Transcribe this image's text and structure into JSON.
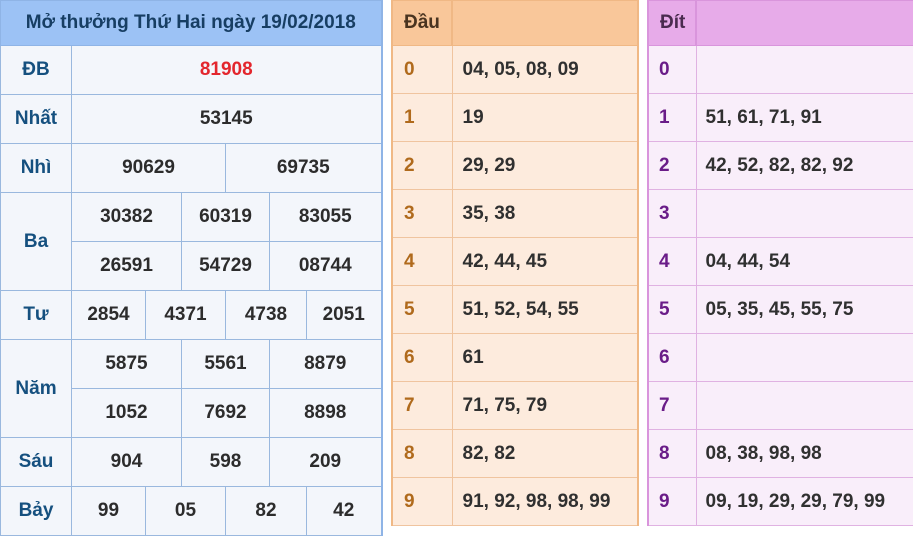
{
  "results": {
    "title": "Mở thưởng Thứ Hai ngày 19/02/2018",
    "rows": [
      {
        "label": "ĐB",
        "values": [
          "81908"
        ]
      },
      {
        "label": "Nhất",
        "values": [
          "53145"
        ]
      },
      {
        "label": "Nhì",
        "values": [
          "90629",
          "69735"
        ]
      },
      {
        "label": "Ba",
        "values": [
          "30382",
          "60319",
          "83055",
          "26591",
          "54729",
          "08744"
        ]
      },
      {
        "label": "Tư",
        "values": [
          "2854",
          "4371",
          "4738",
          "2051"
        ]
      },
      {
        "label": "Năm",
        "values": [
          "5875",
          "5561",
          "8879",
          "1052",
          "7692",
          "8898"
        ]
      },
      {
        "label": "Sáu",
        "values": [
          "904",
          "598",
          "209"
        ]
      },
      {
        "label": "Bảy",
        "values": [
          "99",
          "05",
          "82",
          "42"
        ]
      }
    ]
  },
  "dau": {
    "header": "Đầu",
    "rows": [
      {
        "key": "0",
        "value": "04, 05, 08, 09"
      },
      {
        "key": "1",
        "value": "19"
      },
      {
        "key": "2",
        "value": "29, 29"
      },
      {
        "key": "3",
        "value": "35, 38"
      },
      {
        "key": "4",
        "value": "42, 44, 45"
      },
      {
        "key": "5",
        "value": "51, 52, 54, 55"
      },
      {
        "key": "6",
        "value": "61"
      },
      {
        "key": "7",
        "value": "71, 75, 79"
      },
      {
        "key": "8",
        "value": "82, 82"
      },
      {
        "key": "9",
        "value": "91, 92, 98, 98, 99"
      }
    ]
  },
  "dit": {
    "header": "Đít",
    "rows": [
      {
        "key": "0",
        "value": ""
      },
      {
        "key": "1",
        "value": "51, 61, 71, 91"
      },
      {
        "key": "2",
        "value": "42, 52, 82, 82, 92"
      },
      {
        "key": "3",
        "value": ""
      },
      {
        "key": "4",
        "value": "04, 44, 54"
      },
      {
        "key": "5",
        "value": "05, 35, 45, 55, 75"
      },
      {
        "key": "6",
        "value": ""
      },
      {
        "key": "7",
        "value": ""
      },
      {
        "key": "8",
        "value": "08, 38, 98, 98"
      },
      {
        "key": "9",
        "value": "09, 19, 29, 29, 79, 99"
      }
    ]
  },
  "colors": {
    "special_prize": "#e3262d",
    "results_header": "#9cc2f5",
    "dau_header": "#f9c79a",
    "dit_header": "#e7abe9"
  }
}
